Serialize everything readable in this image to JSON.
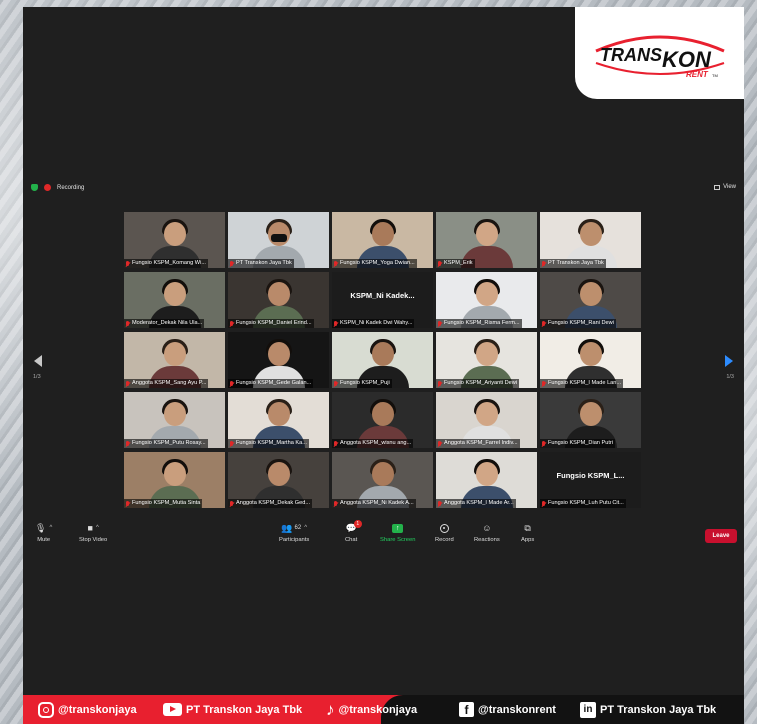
{
  "brand": {
    "logo_line1": "TRANS",
    "logo_line2": "KON",
    "logo_sub": "RENT",
    "logo_tm": "TM"
  },
  "top_bar": {
    "recording_label": "Recording",
    "view_label": "View"
  },
  "pagination": {
    "left_page": "1/3",
    "right_page": "1/3"
  },
  "participants": [
    {
      "label": "Fungsio KSPM_Komang Wi..."
    },
    {
      "label": "PT Transkon Jaya Tbk",
      "active": true
    },
    {
      "label": "Fungsio KSPM_Yoga Dwian..."
    },
    {
      "label": "KSPM_Erik"
    },
    {
      "label": "PT Transkon Jaya Tbk"
    },
    {
      "label": "Moderator_Dekak Nila Ula..."
    },
    {
      "label": "Fungsio KSPM_Daniel Erind..."
    },
    {
      "label": "KSPM_Ni Kadek Dwi Wahy...",
      "name_tile": "KSPM_Ni  Kadek..."
    },
    {
      "label": "Fungsio KSPM_Risma Ferm..."
    },
    {
      "label": "Fungsio KSPM_Rani Dewi"
    },
    {
      "label": "Anggota KSPM_Sang Ayu P..."
    },
    {
      "label": "Fungsio KSPM_Gede Galan..."
    },
    {
      "label": "Fungsio KSPM_Puji"
    },
    {
      "label": "Fungsio KSPM_Ariyanti Dewi"
    },
    {
      "label": "Fungsio KSPM_I Made Lan..."
    },
    {
      "label": "Fungsio KSPM_Putu Rosay..."
    },
    {
      "label": "Fungsio KSPM_Martha Ka..."
    },
    {
      "label": "Anggota KSPM_wisnu ang..."
    },
    {
      "label": "Anggota KSPM_Farrel Indiv..."
    },
    {
      "label": "Fungsio KSPM_Dian Putri"
    },
    {
      "label": "Fungsio KSPM_Mutia Sinta"
    },
    {
      "label": "Anggota KSPM_Dekak Ged..."
    },
    {
      "label": "Anggota KSPM_Ni Kadek A..."
    },
    {
      "label": "Anggota KSPM_I Made Ar..."
    },
    {
      "label": "Fungsio KSPM_Luh Putu Cit...",
      "name_tile": "Fungsio  KSPM_L..."
    }
  ],
  "toolbar": {
    "mute": "Mute",
    "stop_video": "Stop Video",
    "participants": "Participants",
    "participants_count": "62",
    "chat": "Chat",
    "chat_badge": "1",
    "share_screen": "Share Screen",
    "record": "Record",
    "reactions": "Reactions",
    "apps": "Apps",
    "leave": "Leave"
  },
  "footer": {
    "instagram": "@transkonjaya",
    "youtube": "PT Transkon Jaya Tbk",
    "tiktok": "@transkonjaya",
    "facebook": "@transkonrent",
    "linkedin": "PT Transkon Jaya Tbk"
  },
  "colors": {
    "brand_red": "#e8202f",
    "zoom_bg": "#1f1f1f",
    "active_speaker": "#c7e23a",
    "share_green": "#23b24b",
    "leave_red": "#c8102e"
  }
}
